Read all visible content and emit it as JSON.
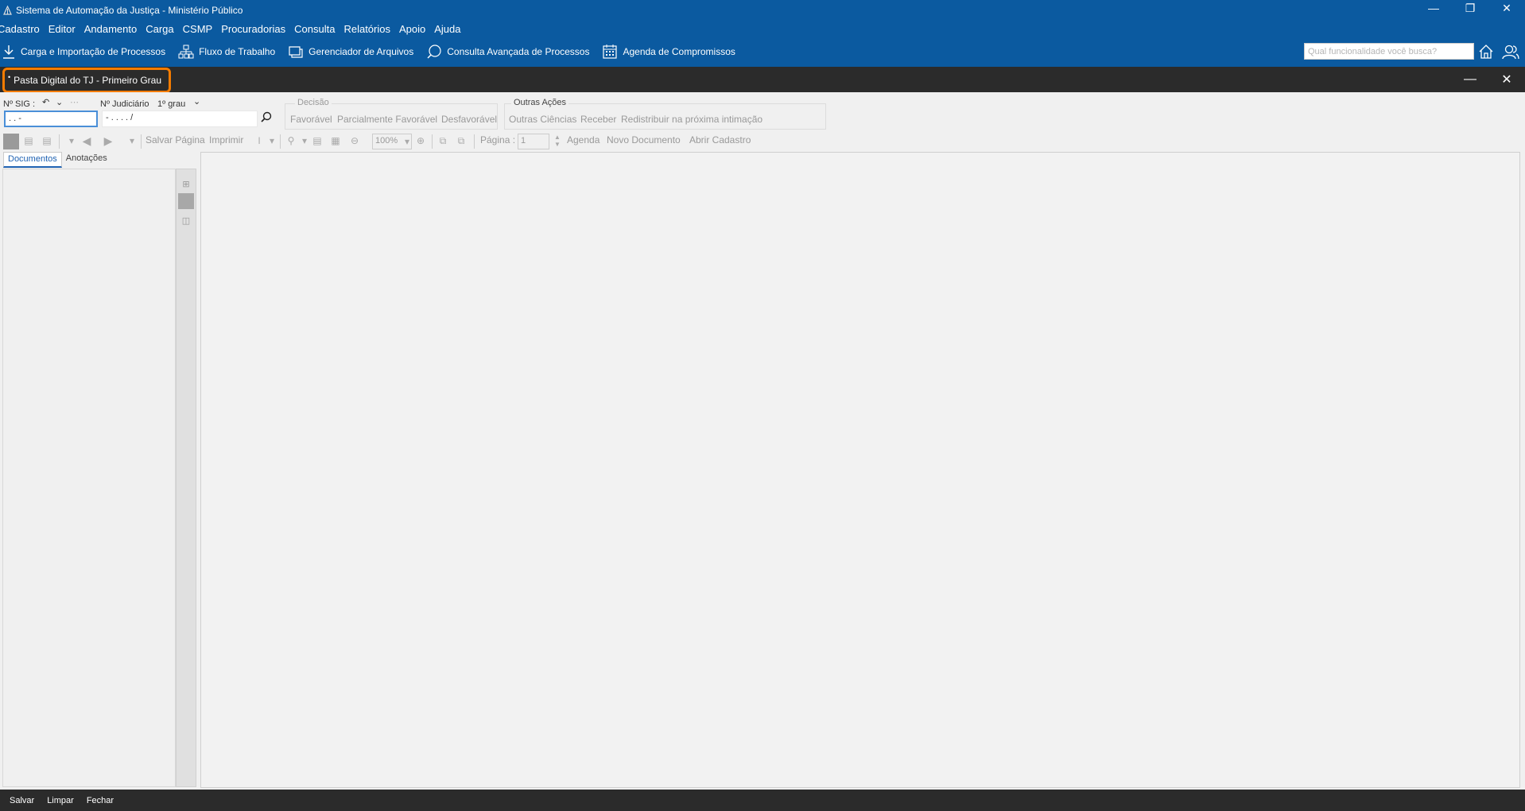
{
  "titlebar": {
    "title": "Sistema de Automação da Justiça - Ministério Público"
  },
  "menu": [
    "Cadastro",
    "Editor",
    "Andamento",
    "Carga",
    "CSMP",
    "Procuradorias",
    "Consulta",
    "Relatórios",
    "Apoio",
    "Ajuda"
  ],
  "quickbar": {
    "items": [
      {
        "label": "Carga e Importação de Processos",
        "icon": "download-icon"
      },
      {
        "label": "Fluxo de Trabalho",
        "icon": "workflow-icon"
      },
      {
        "label": "Gerenciador de Arquivos",
        "icon": "file-manager-icon"
      },
      {
        "label": "Consulta Avançada de Processos",
        "icon": "search-chat-icon"
      },
      {
        "label": "Agenda de Compromissos",
        "icon": "calendar-icon"
      }
    ],
    "search_placeholder": "Qual funcionalidade você busca?"
  },
  "docwindow": {
    "title": "Pasta Digital do TJ - Primeiro Grau"
  },
  "form": {
    "sig_label": "Nº SIG :",
    "sig_value": " .  .       -",
    "judiciario_label": "Nº Judiciário",
    "grau_value": "1º grau",
    "judiciario_value": "        - .     . . .    /",
    "decisao": {
      "title": "Decisão",
      "buttons": [
        "Favorável",
        "Parcialmente Favorável",
        "Desfavorável"
      ]
    },
    "outras": {
      "title": "Outras Ações",
      "buttons": [
        "Outras Ciências",
        "Receber",
        "Redistribuir na próxima intimação"
      ]
    }
  },
  "viewbar": {
    "salvar_pagina": "Salvar Página",
    "imprimir": "Imprimir",
    "zoom": "100%",
    "pagina_label": "Página :",
    "pagina_value": "1",
    "agenda": "Agenda",
    "novo_documento": "Novo Documento",
    "abrir_cadastro": "Abrir Cadastro"
  },
  "sidetabs": [
    "Documentos",
    "Anotações"
  ],
  "statusbar": [
    "Salvar",
    "Limpar",
    "Fechar"
  ],
  "colors": {
    "primary": "#0b5aa0",
    "header_dark": "#2b2b2b",
    "highlight": "#f57c00"
  }
}
